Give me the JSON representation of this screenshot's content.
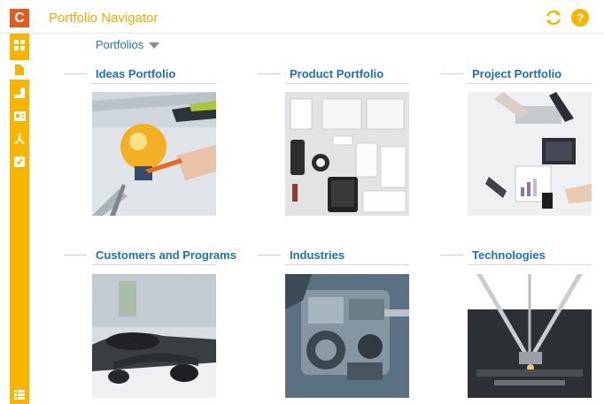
{
  "app": {
    "logo_letter": "C",
    "title": "Portfolio Navigator"
  },
  "nav": {
    "dropdown_label": "Portfolios"
  },
  "tiles": [
    {
      "title": "Ideas Portfolio",
      "image": "lightbulb-sketch-image"
    },
    {
      "title": "Product Portfolio",
      "image": "product-mockup-flatlay-image"
    },
    {
      "title": "Project Portfolio",
      "image": "meeting-table-devices-image"
    },
    {
      "title": "Customers and Programs",
      "image": "phone-headset-image"
    },
    {
      "title": "Industries",
      "image": "engine-image"
    },
    {
      "title": "Technologies",
      "image": "delta-robot-printer-image"
    }
  ],
  "sidebar": {
    "items": [
      "dashboard-icon",
      "document-icon",
      "chart-icon",
      "card-icon",
      "branch-icon",
      "checklist-icon",
      "list-icon"
    ]
  },
  "colors": {
    "accent": "#f7b500",
    "title": "#f4a800",
    "link": "#1f6fb5",
    "logo": "#e35b1e"
  }
}
